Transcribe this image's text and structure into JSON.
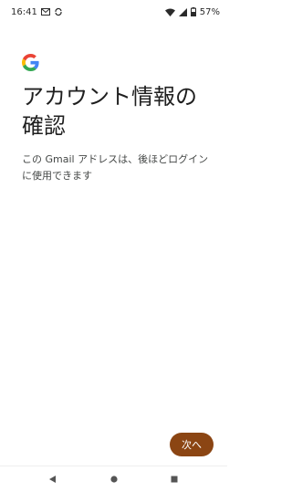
{
  "status_bar": {
    "time": "16:41",
    "battery_percent": "57%",
    "left_icons": [
      "mail-icon",
      "sync-icon"
    ],
    "right_icons": [
      "wifi-icon",
      "cell-signal-icon",
      "battery-icon"
    ]
  },
  "header": {
    "logo": "google-logo",
    "title": "アカウント情報の確認"
  },
  "main": {
    "description": "この Gmail アドレスは、後ほどログインに使用できます"
  },
  "footer": {
    "next_label": "次へ",
    "next_color": "#8b4513"
  },
  "nav_bar": {
    "buttons": [
      "back-icon",
      "home-icon",
      "recents-icon"
    ]
  }
}
